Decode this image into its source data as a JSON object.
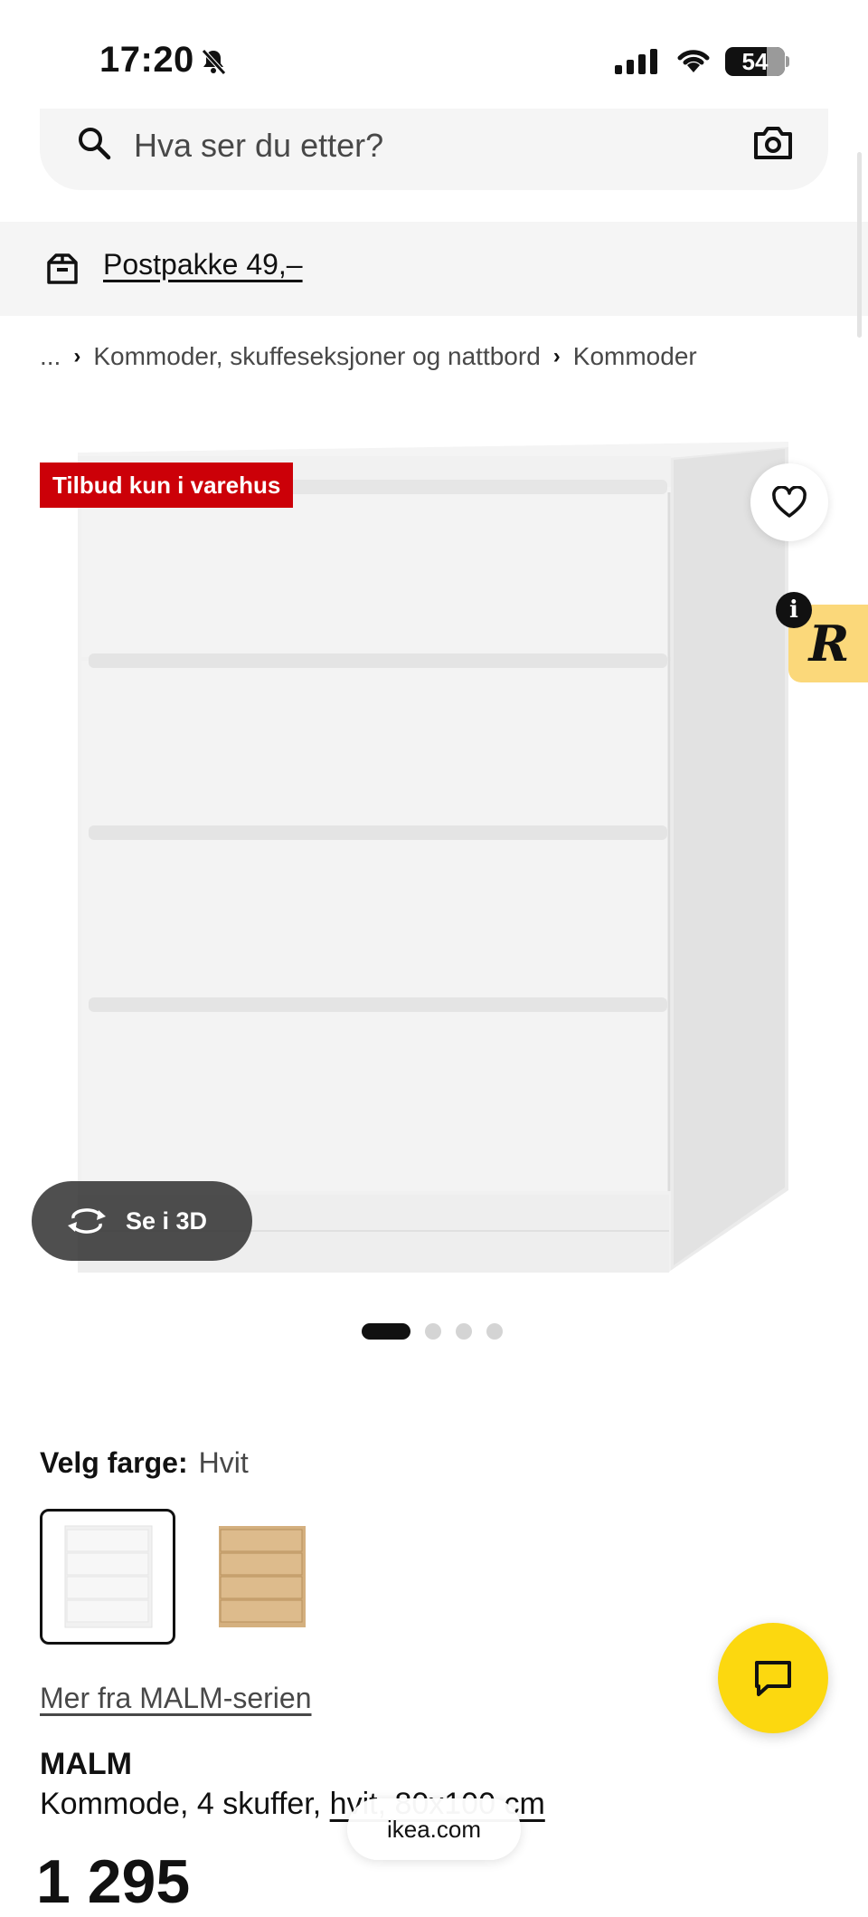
{
  "status_bar": {
    "time": "17:20",
    "battery": "54"
  },
  "search": {
    "placeholder": "Hva ser du etter?"
  },
  "banner": {
    "text": "Postpakke 49,–"
  },
  "breadcrumb": {
    "ellipsis": "...",
    "items": [
      "Kommoder, skuffeseksjoner og nattbord",
      "Kommoder"
    ]
  },
  "image": {
    "badge": "Tilbud kun i varehus",
    "view3d_label": "Se i 3D",
    "slide_count": 4,
    "active_slide": 1,
    "partner_badge": "R",
    "info": "i"
  },
  "color": {
    "label": "Velg farge:",
    "selected": "Hvit",
    "options": [
      "Hvit",
      "Hvitbeiset eikefiner"
    ]
  },
  "series_link": "Mer fra MALM-serien",
  "product": {
    "name": "MALM",
    "desc_prefix": "Kommode, 4 skuffer, ",
    "desc_link": "hvit, 80x100 cm",
    "price": "1 295"
  },
  "browser": {
    "url": "ikea.com"
  },
  "colors": {
    "badge": "#cc0008",
    "chat": "#fcd80f",
    "partner_tab": "#fbd87a"
  }
}
